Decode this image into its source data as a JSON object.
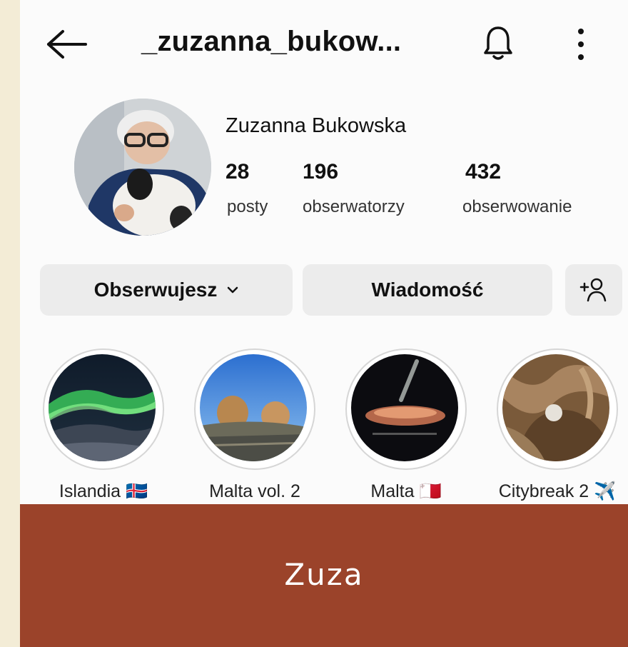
{
  "header": {
    "username": "_zuzanna_bukow...",
    "back_icon": "arrow-left-icon",
    "bell_icon": "bell-icon",
    "more_icon": "more-vertical-icon"
  },
  "profile": {
    "full_name": "Zuzanna Bukowska",
    "stats": [
      {
        "value": "28",
        "label": "posty"
      },
      {
        "value": "196",
        "label": "obserwatorzy"
      },
      {
        "value": "432",
        "label": "obserwowanie"
      }
    ]
  },
  "actions": {
    "follow_label": "Obserwujesz",
    "message_label": "Wiadomość",
    "add_user_icon": "add-user-icon"
  },
  "highlights": [
    {
      "label": "Islandia 🇮🇸"
    },
    {
      "label": "Malta vol. 2"
    },
    {
      "label": "Malta 🇲🇹"
    },
    {
      "label": "Citybreak 2 ✈️"
    }
  ],
  "banner": {
    "title": "Zuza",
    "color": "#9b432a"
  }
}
